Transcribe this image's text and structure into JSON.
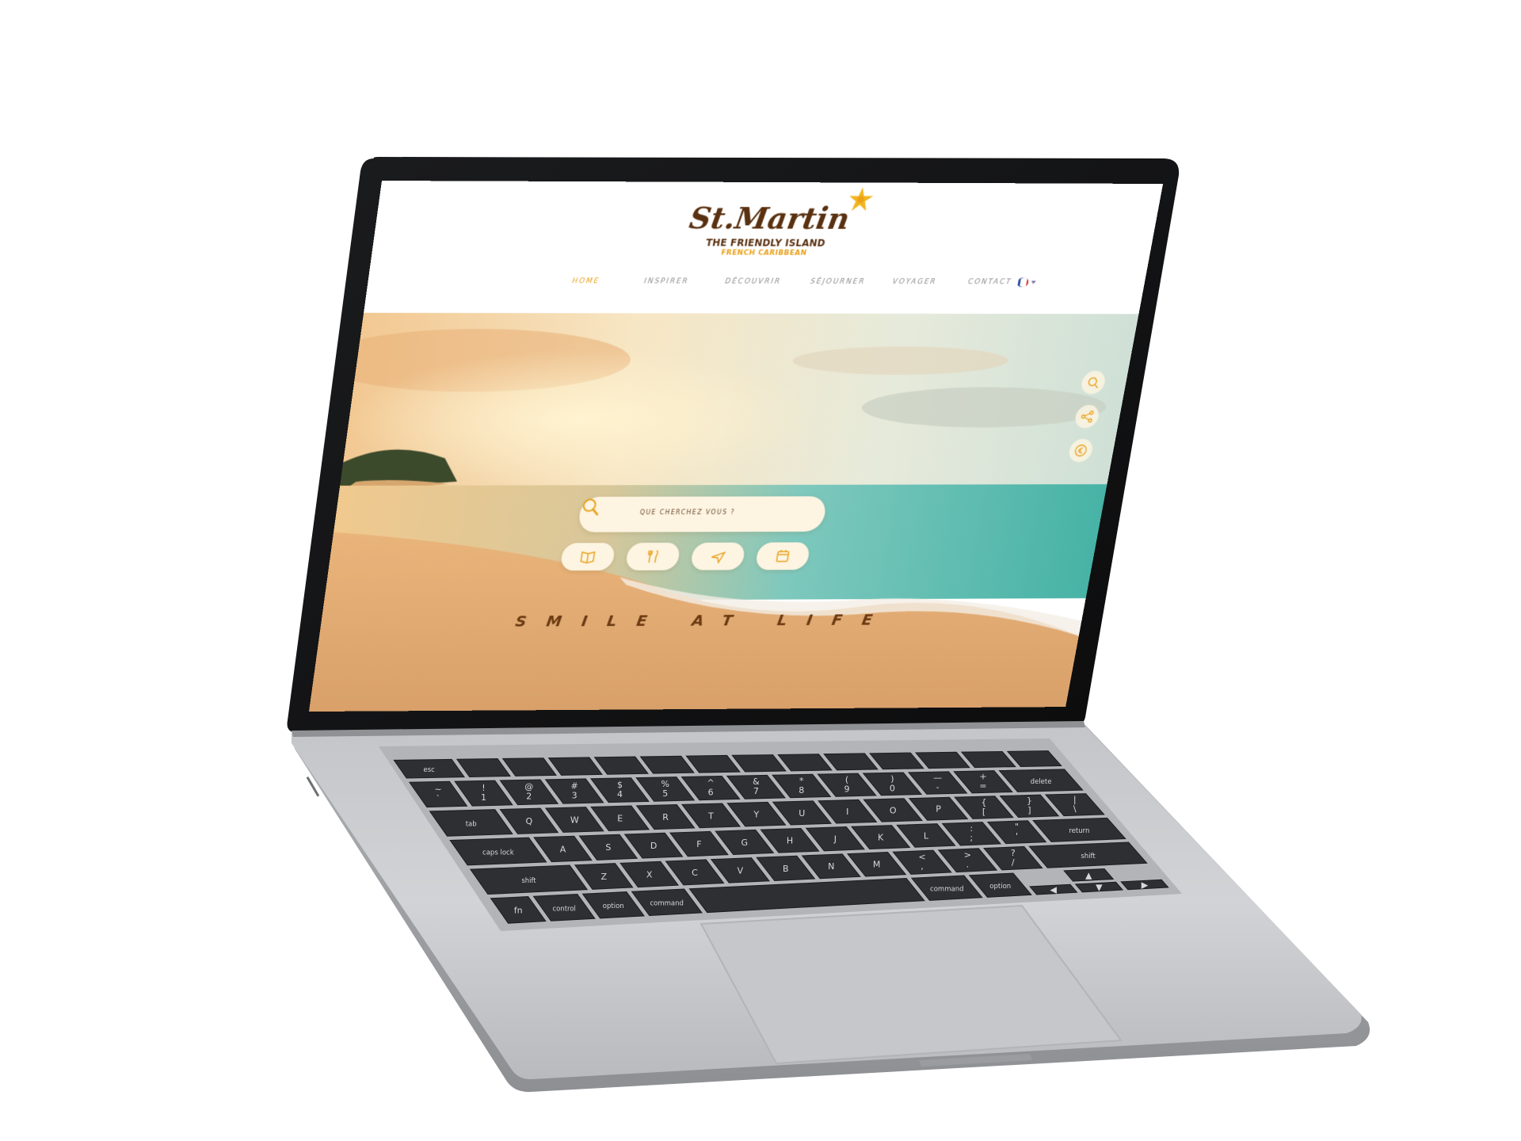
{
  "site": {
    "logo_title": "St.Martin",
    "logo_subtitle": "THE FRIENDLY ISLAND",
    "logo_tagline": "FRENCH CARIBBEAN",
    "nav": [
      {
        "label": "HOME",
        "active": true
      },
      {
        "label": "INSPIRER",
        "active": false
      },
      {
        "label": "DÉCOUVRIR",
        "active": false
      },
      {
        "label": "SÉJOURNER",
        "active": false
      },
      {
        "label": "VOYAGER",
        "active": false
      },
      {
        "label": "CONTACT",
        "active": false
      }
    ],
    "language": "FR",
    "search": {
      "placeholder": "QUE CHERCHEZ VOUS ?"
    },
    "categories": [
      {
        "icon": "book-icon"
      },
      {
        "icon": "fork-knife-icon"
      },
      {
        "icon": "plane-icon"
      },
      {
        "icon": "calendar-icon"
      }
    ],
    "side_buttons": [
      {
        "icon": "search-icon"
      },
      {
        "icon": "share-icon"
      },
      {
        "icon": "euro-icon"
      }
    ],
    "hero_tagline": "SMILE AT LIFE"
  },
  "keyboard": {
    "row0": [
      "esc"
    ],
    "row1": [
      "~\n`",
      "!\n1",
      "@\n2",
      "#\n3",
      "$\n4",
      "%\n5",
      "^\n6",
      "&\n7",
      "*\n8",
      "(\n9",
      ")\n0",
      "—\n-",
      "+\n=",
      "delete"
    ],
    "row2": [
      "tab",
      "Q",
      "W",
      "E",
      "R",
      "T",
      "Y",
      "U",
      "I",
      "O",
      "P",
      "{\n[",
      "}\n]",
      "|\n\\"
    ],
    "row3": [
      "caps lock",
      "A",
      "S",
      "D",
      "F",
      "G",
      "H",
      "J",
      "K",
      "L",
      ":\n;",
      "\"\n'",
      "return"
    ],
    "row4": [
      "shift",
      "Z",
      "X",
      "C",
      "V",
      "B",
      "N",
      "M",
      "<\n,",
      ">\n.",
      "?\n/",
      "shift"
    ],
    "row5": [
      "fn",
      "control",
      "option",
      "command",
      "",
      "command",
      "option"
    ]
  },
  "colors": {
    "brand_brown": "#5a3110",
    "brand_orange": "#e9a11a",
    "nav_gray": "#8a8a8a",
    "button_cream": "#fdf4e2",
    "laptop_silver": "#c9cacd",
    "key_dark": "#2e2f33"
  }
}
